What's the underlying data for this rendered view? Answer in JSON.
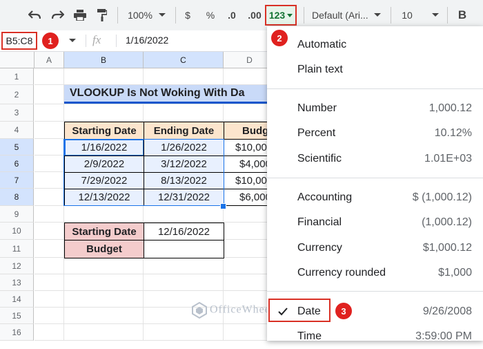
{
  "toolbar": {
    "zoom": "100%",
    "currency": "$",
    "percent": "%",
    "dec_decrease": ".0",
    "dec_increase": ".00",
    "more_formats": "123",
    "font_name": "Default (Ari...",
    "font_size": "10",
    "bold": "B"
  },
  "formula_bar": {
    "name_box": "B5:C8",
    "fx": "fx",
    "value": "1/16/2022"
  },
  "badges": [
    "1",
    "2",
    "3"
  ],
  "columns": [
    "A",
    "B",
    "C",
    "D"
  ],
  "rows": [
    "1",
    "2",
    "3",
    "4",
    "5",
    "6",
    "7",
    "8",
    "9",
    "10",
    "11",
    "12",
    "13",
    "14",
    "15",
    "16"
  ],
  "sheet": {
    "title": "VLOOKUP Is Not Woking With Da",
    "headers": [
      "Starting Date",
      "Ending Date",
      "Budg"
    ],
    "data": [
      [
        "1/16/2022",
        "1/26/2022",
        "$10,00"
      ],
      [
        "2/9/2022",
        "3/12/2022",
        "$4,000"
      ],
      [
        "7/29/2022",
        "8/13/2022",
        "$10,00"
      ],
      [
        "12/13/2022",
        "12/31/2022",
        "$6,000"
      ]
    ],
    "lookup_label": "Starting Date",
    "lookup_value": "12/16/2022",
    "budget_label": "Budget",
    "budget_value": ""
  },
  "menu": {
    "items": [
      {
        "label": "Automatic",
        "value": ""
      },
      {
        "label": "Plain text",
        "value": ""
      },
      {
        "label": "Number",
        "value": "1,000.12"
      },
      {
        "label": "Percent",
        "value": "10.12%"
      },
      {
        "label": "Scientific",
        "value": "1.01E+03"
      },
      {
        "label": "Accounting",
        "value": "$ (1,000.12)"
      },
      {
        "label": "Financial",
        "value": "(1,000.12)"
      },
      {
        "label": "Currency",
        "value": "$1,000.12"
      },
      {
        "label": "Currency rounded",
        "value": "$1,000"
      },
      {
        "label": "Date",
        "value": "9/26/2008"
      },
      {
        "label": "Time",
        "value": "3:59:00 PM"
      }
    ]
  },
  "watermark": "OfficeWheel",
  "colors": {
    "accent_red": "#d93025",
    "selection": "#e8f0fe",
    "header_fill": "#fce5cd",
    "title_fill": "#c9daf8"
  }
}
